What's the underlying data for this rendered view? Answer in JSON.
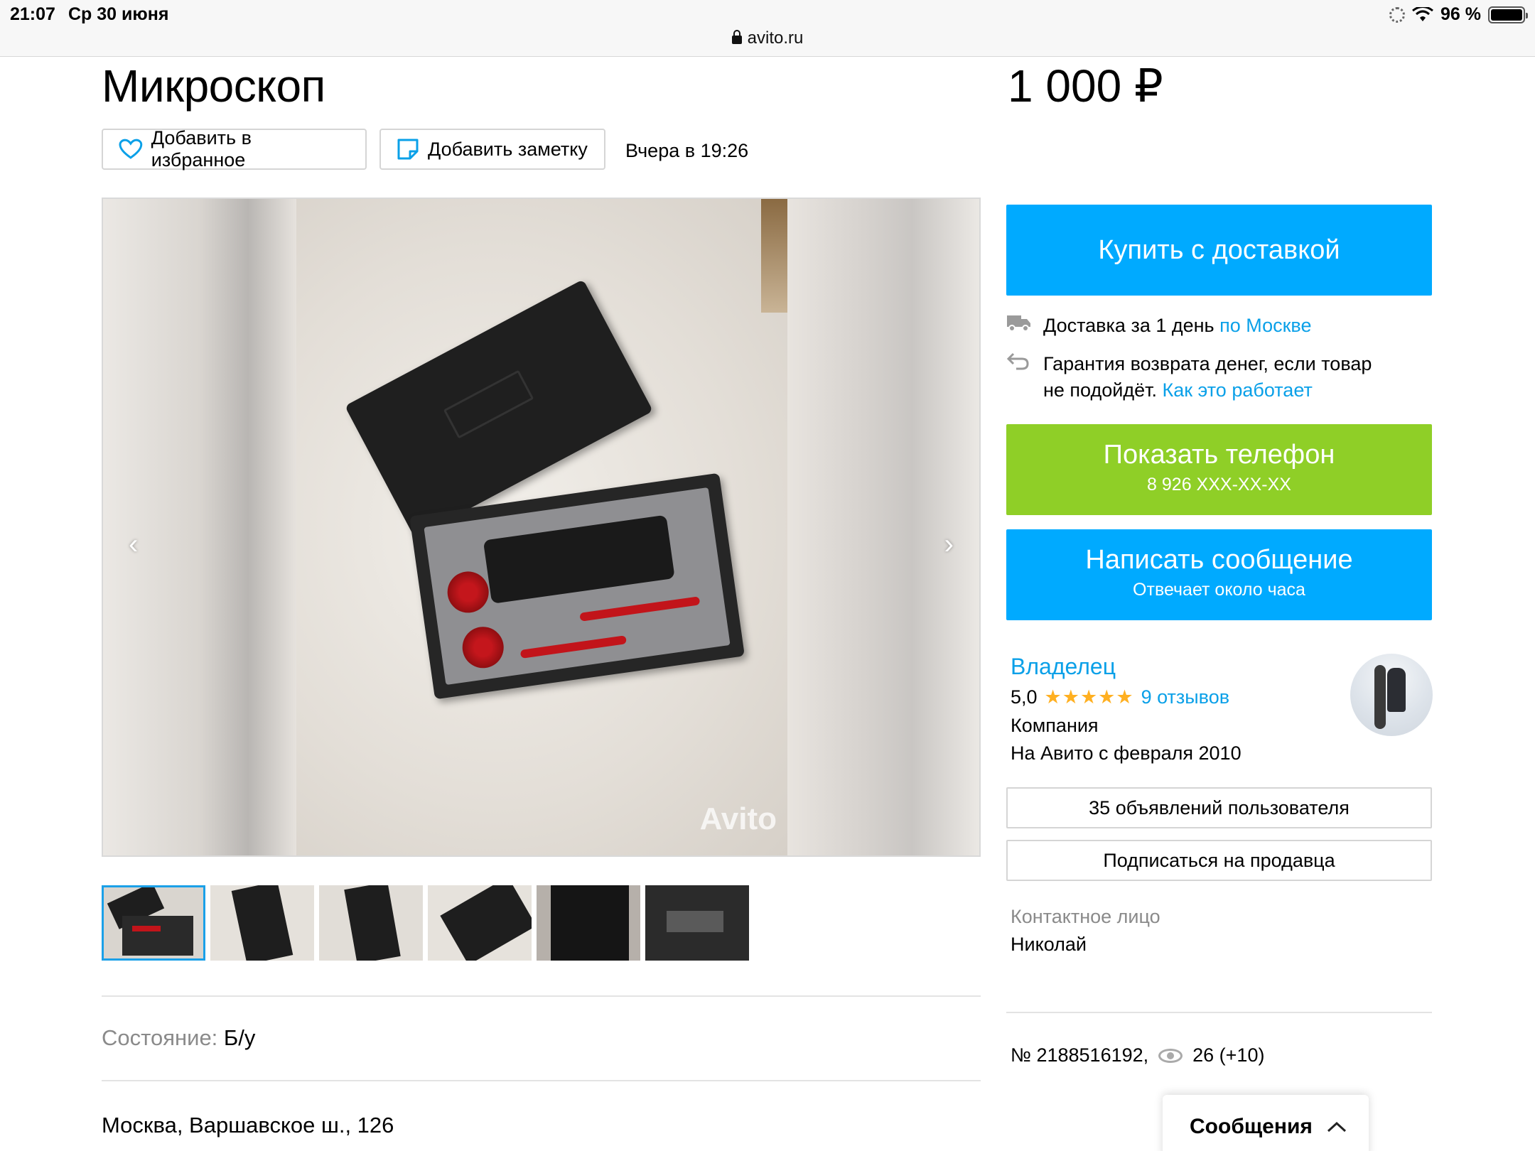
{
  "status_bar": {
    "time": "21:07",
    "date": "Ср 30 июня",
    "url": "avito.ru",
    "battery": "96 %"
  },
  "listing": {
    "title": "Микроскоп",
    "price": "1 000 ₽",
    "favorite_label": "Добавить в избранное",
    "note_label": "Добавить заметку",
    "posted": "Вчера в 19:26",
    "watermark": "Avito",
    "thumbnail_count": 6,
    "active_thumbnail": 1
  },
  "params": {
    "condition_label": "Состояние:",
    "condition_value": "Б/у",
    "address": "Москва, Варшавское ш., 126"
  },
  "actions": {
    "buy_label": "Купить с доставкой",
    "delivery_text": "Доставка за 1 день",
    "delivery_link": "по Москве",
    "guarantee_text_1": "Гарантия возврата денег, если товар",
    "guarantee_text_2": "не подойдёт.",
    "guarantee_link": "Как это работает",
    "phone_label": "Показать телефон",
    "phone_number": "8 926 XXX-XX-XX",
    "message_label": "Написать сообщение",
    "message_sub": "Отвечает около часа"
  },
  "seller": {
    "name": "Владелец",
    "rating": "5,0",
    "stars": "★★★★★",
    "reviews": "9 отзывов",
    "type": "Компания",
    "since": "На Авито с февраля 2010",
    "listings_button": "35 объявлений пользователя",
    "subscribe_button": "Подписаться на продавца",
    "contact_label": "Контактное лицо",
    "contact_name": "Николай"
  },
  "stats": {
    "ad_number": "№ 2188516192,",
    "views": "26 (+10)"
  },
  "messages_panel": {
    "label": "Сообщения"
  },
  "colors": {
    "accent_blue": "#00aaff",
    "phone_green": "#8fcf27",
    "link_blue": "#0aa0e8",
    "star_orange": "#ffb021"
  }
}
